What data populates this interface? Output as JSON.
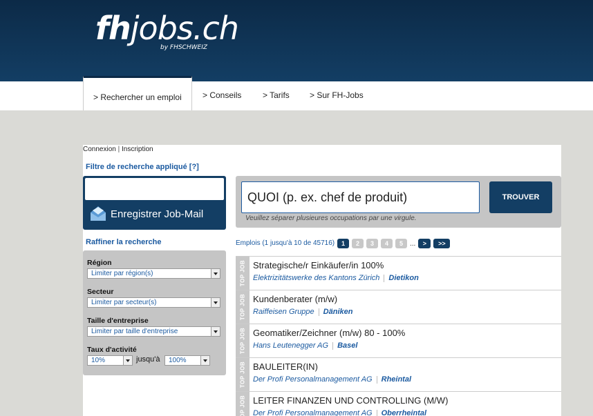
{
  "header": {
    "logo_bold": "fh",
    "logo_rest": "jobs.ch",
    "logo_sub": "by FHSCHWEIZ"
  },
  "nav": {
    "items": [
      "> Rechercher un emploi",
      "> Conseils",
      "> Tarifs",
      "> Sur FH-Jobs"
    ]
  },
  "account": {
    "login": "Connexion",
    "separator": "|",
    "register": "Inscription"
  },
  "sidebar": {
    "filter_title": "Filtre de recherche appliqué",
    "filter_help": "[?]",
    "jobmail_label": "Enregistrer Job-Mail",
    "refine_title": "Raffiner la recherche",
    "region_label": "Région",
    "region_value": "Limiter par région(s)",
    "sector_label": "Secteur",
    "sector_value": "Limiter par secteur(s)",
    "size_label": "Taille d'entreprise",
    "size_value": "Limiter par taille d'entreprise",
    "activity_label": "Taux d'activité",
    "activity_from": "10%",
    "activity_to_label": "jusqu'à",
    "activity_to": "100%"
  },
  "search": {
    "placeholder": "QUOI (p. ex. chef de produit)",
    "hint": "Veuillez séparer plusieures occupations par une virgule.",
    "button": "TROUVER"
  },
  "results": {
    "count_text": "Emplois (1 jusqu'à 10 de 45716)",
    "pages": [
      "1",
      "2",
      "3",
      "4",
      "5"
    ],
    "ellipsis": "...",
    "next": ">",
    "last": ">>",
    "tag": "TOP JOB",
    "jobs": [
      {
        "title": "Strategische/r Einkäufer/in 100%",
        "company": "Elektrizitätswerke des Kantons Zürich",
        "location": "Dietikon"
      },
      {
        "title": "Kundenberater (m/w)",
        "company": "Raiffeisen Gruppe",
        "location": "Däniken"
      },
      {
        "title": "Geomatiker/Zeichner (m/w) 80 - 100%",
        "company": "Hans Leutenegger AG",
        "location": "Basel"
      },
      {
        "title": "BAULEITER(IN)",
        "company": "Der Profi Personalmanagement AG",
        "location": "Rheintal"
      },
      {
        "title": "LEITER FINANZEN UND CONTROLLING (M/W)",
        "company": "Der Profi Personalmanagement AG",
        "location": "Oberrheintal"
      }
    ]
  },
  "colors": {
    "brand_dark": "#133e64",
    "link_blue": "#1b5aa0",
    "panel_gray": "#c5c5c5"
  }
}
